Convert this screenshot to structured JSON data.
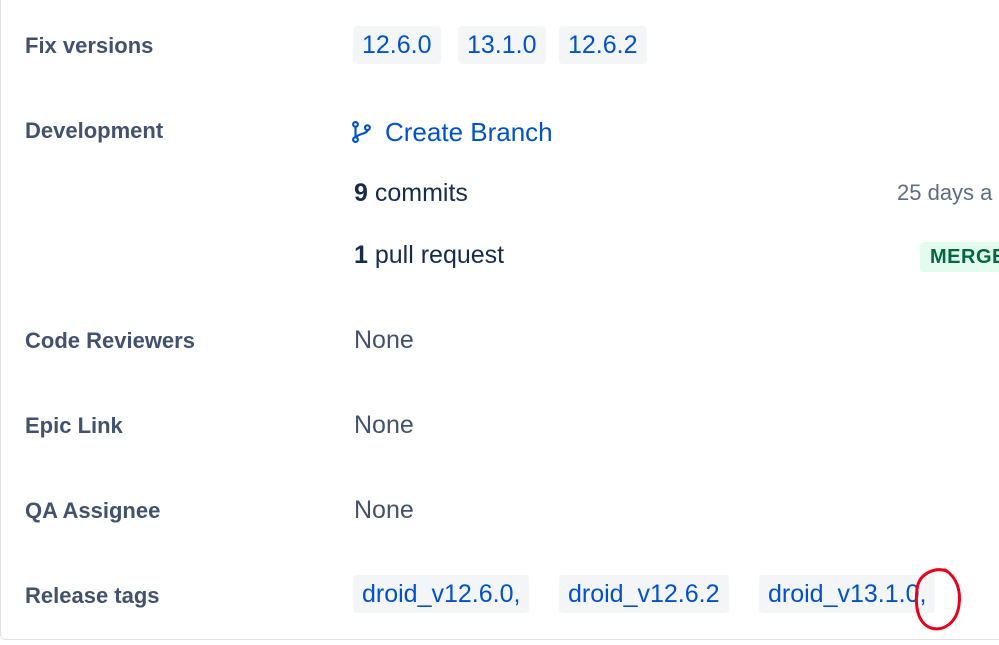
{
  "fields": {
    "fix_versions": {
      "label": "Fix versions",
      "chips": [
        "12.6.0",
        "13.1.0",
        "12.6.2"
      ]
    },
    "development": {
      "label": "Development",
      "create_branch_label": "Create Branch",
      "commits_count": "9",
      "commits_text": "commits",
      "commits_time": "25 days a",
      "pr_count": "1",
      "pr_text": "pull request",
      "pr_status": "MERGE"
    },
    "code_reviewers": {
      "label": "Code Reviewers",
      "value": "None"
    },
    "epic_link": {
      "label": "Epic Link",
      "value": "None"
    },
    "qa_assignee": {
      "label": "QA Assignee",
      "value": "None"
    },
    "release_tags": {
      "label": "Release tags",
      "chips": [
        "droid_v12.6.0,",
        "droid_v12.6.2",
        "droid_v13.1.0,"
      ]
    }
  },
  "colors": {
    "link": "#0052cc",
    "label": "#42526e",
    "chip_bg": "#f4f5f7",
    "merged_bg": "#e3fcef",
    "merged_text": "#006644",
    "annotation": "#e8001c"
  },
  "icons": {
    "create_branch": "git-branch-icon",
    "annotation": "red-circle-annotation"
  }
}
